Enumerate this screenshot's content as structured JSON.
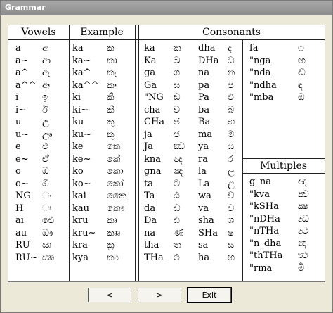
{
  "window": {
    "title": "Grammar"
  },
  "headers": {
    "vowels": "Vowels",
    "example": "Example",
    "consonants": "Consonants",
    "multiples": "Multiples"
  },
  "vowels": {
    "roman": [
      "a",
      "a~",
      "a^",
      "a^^",
      "i",
      "i~",
      "u",
      "u~",
      "e",
      "e~",
      "o",
      "o~",
      "NG",
      "H",
      "ai",
      "au",
      "RU",
      "RU~"
    ],
    "sinhala": [
      "අ",
      "ආ",
      "ඇ",
      "ඈ",
      "ඉ",
      "ඊ",
      "උ",
      "ඌ",
      "එ",
      "ඒ",
      "ඔ",
      "ඕ",
      "ං",
      "ඃ",
      "ඓ",
      "ඖ",
      "ඍ",
      "ඎ"
    ]
  },
  "example": {
    "roman": [
      "ka",
      "ka~",
      "ka^",
      "ka^^",
      "ki",
      "ki~",
      "ku",
      "ku~",
      "ke",
      "ke~",
      "ko",
      "ko~",
      "kai",
      "kau",
      "kru",
      "kru~",
      "kra",
      "kya"
    ],
    "sinhala": [
      "ක",
      "කා",
      "කැ",
      "කෑ",
      "කි",
      "කී",
      "කු",
      "කූ",
      "කෙ",
      "කේ",
      "කො",
      "කෝ",
      "කෛ",
      "කෞ",
      "කෘ",
      "කෲ",
      "ක්‍ර",
      "ක්‍ය"
    ]
  },
  "consonants": {
    "col1_roman": [
      "ka",
      "Ka",
      "ga",
      "Ga",
      "\"NG",
      "cha",
      "CHa",
      "ja",
      "Ja",
      "kna",
      "gna",
      "ta",
      "Ta",
      "da",
      "Da",
      "na",
      "tha",
      "THa"
    ],
    "col1_sinhala": [
      "ක",
      "ඛ",
      "ග",
      "ඝ",
      "ඞ",
      "ච",
      "ඡ",
      "ජ",
      "ඣ",
      "ඥ",
      "ඤ",
      "ට",
      "ඨ",
      "ඩ",
      "ඪ",
      "ණ",
      "ත",
      "ථ"
    ],
    "col2_roman": [
      "dha",
      "DHa",
      "na",
      "pa",
      "Pa",
      "ba",
      "Ba",
      "ma",
      "ya",
      "ra",
      "la",
      "La",
      "wa",
      "va",
      "sha",
      "SHa",
      "sa",
      "ha"
    ],
    "col2_sinhala": [
      "ද",
      "ධ",
      "න",
      "ප",
      "ඵ",
      "බ",
      "භ",
      "ම",
      "ය",
      "ර",
      "ල",
      "ළ",
      "ව",
      "ව",
      "ශ",
      "ෂ",
      "ස",
      "හ"
    ],
    "col3_roman": [
      "fa",
      "\"nga",
      "\"nda",
      "\"ndha",
      "\"mba"
    ],
    "col3_sinhala": [
      "ෆ",
      "ඟ",
      "ඬ",
      "ඳ",
      "ඹ"
    ]
  },
  "multiples": {
    "roman": [
      "g_na",
      "\"kva",
      "\"kSHa",
      "\"nDHa",
      "\"nTHa",
      "\"n_dha",
      "\"thTHa",
      "\"rma"
    ],
    "sinhala": [
      "ඥ",
      "ක්‍ව",
      "ක්‍ෂ",
      "න්‍ධ",
      "න්‍ථ",
      "න්‍ද",
      "ත්‍ථ",
      "ර්‍ම"
    ]
  },
  "buttons": {
    "prev": "<",
    "next": ">",
    "exit": "Exit"
  }
}
